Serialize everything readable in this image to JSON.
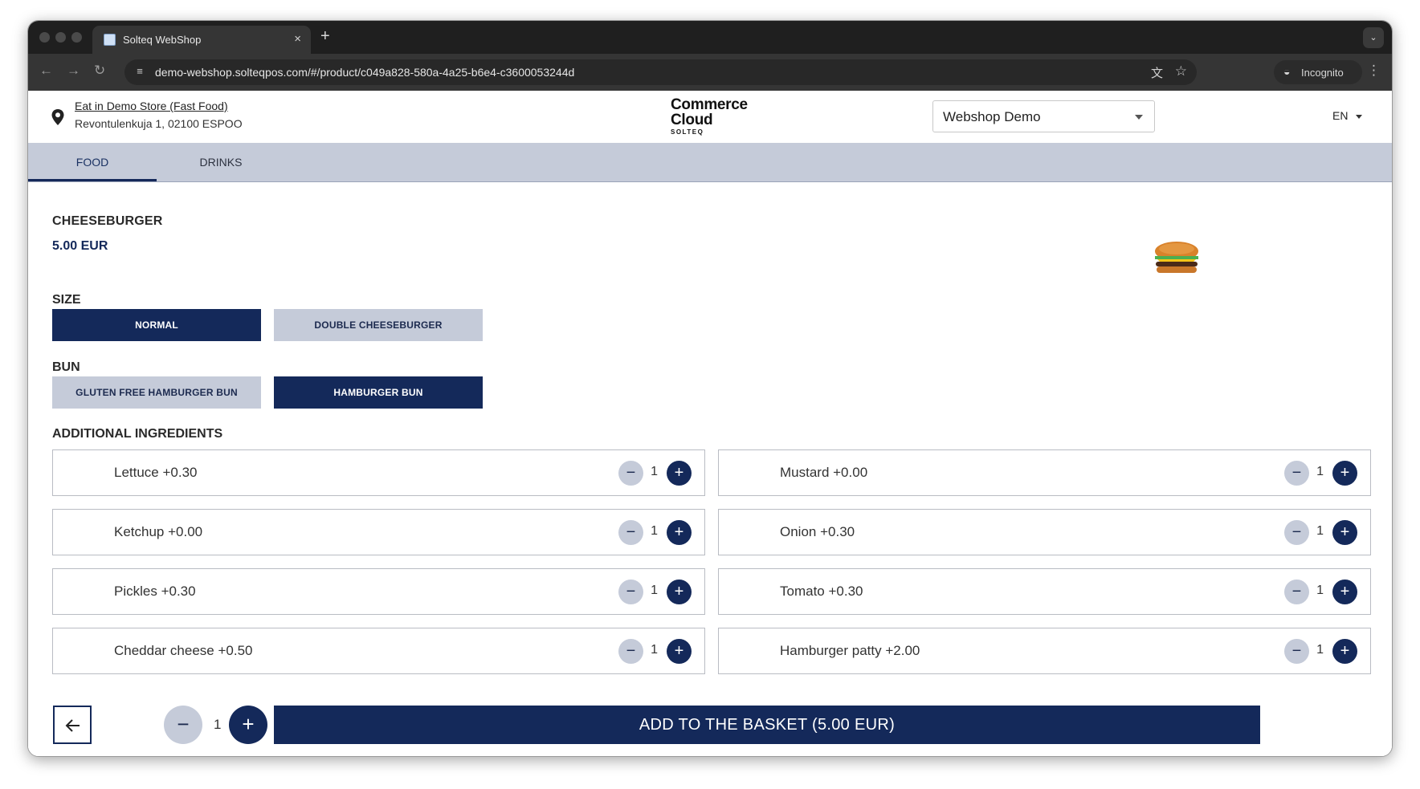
{
  "browser": {
    "tab_title": "Solteq WebShop",
    "tab_close": "×",
    "new_tab": "+",
    "url": "demo-webshop.solteqpos.com/#/product/c049a828-580a-4a25-b6e4-c3600053244d",
    "incognito_label": "Incognito"
  },
  "header": {
    "store_name": "Eat in Demo Store (Fast Food)",
    "store_address": "Revontulenkuja 1, 02100 ESPOO",
    "logo_line1": "Commerce",
    "logo_line2": "Cloud",
    "logo_line3": "SOLTEQ",
    "store_select_value": "Webshop Demo",
    "language": "EN"
  },
  "categories": [
    {
      "label": "FOOD",
      "active": true
    },
    {
      "label": "DRINKS",
      "active": false
    }
  ],
  "product": {
    "name": "CHEESEBURGER",
    "price": "5.00 EUR"
  },
  "size": {
    "title": "SIZE",
    "options": [
      {
        "label": "NORMAL",
        "selected": true
      },
      {
        "label": "DOUBLE CHEESEBURGER",
        "selected": false
      }
    ]
  },
  "bun": {
    "title": "BUN",
    "options": [
      {
        "label": "GLUTEN FREE HAMBURGER BUN",
        "selected": false
      },
      {
        "label": "HAMBURGER BUN",
        "selected": true
      }
    ]
  },
  "ingredients": {
    "title": "ADDITIONAL INGREDIENTS",
    "items": [
      {
        "label": "Lettuce +0.30",
        "qty": "1"
      },
      {
        "label": "Mustard +0.00",
        "qty": "1"
      },
      {
        "label": "Ketchup +0.00",
        "qty": "1"
      },
      {
        "label": "Onion +0.30",
        "qty": "1"
      },
      {
        "label": "Pickles +0.30",
        "qty": "1"
      },
      {
        "label": "Tomato +0.30",
        "qty": "1"
      },
      {
        "label": "Cheddar cheese +0.50",
        "qty": "1"
      },
      {
        "label": "Hamburger patty +2.00",
        "qty": "1"
      }
    ]
  },
  "bottom": {
    "quantity": "1",
    "add_label": "ADD TO THE BASKET (5.00 EUR)"
  },
  "colors": {
    "primary": "#14295a",
    "secondary": "#c5cbd9"
  }
}
